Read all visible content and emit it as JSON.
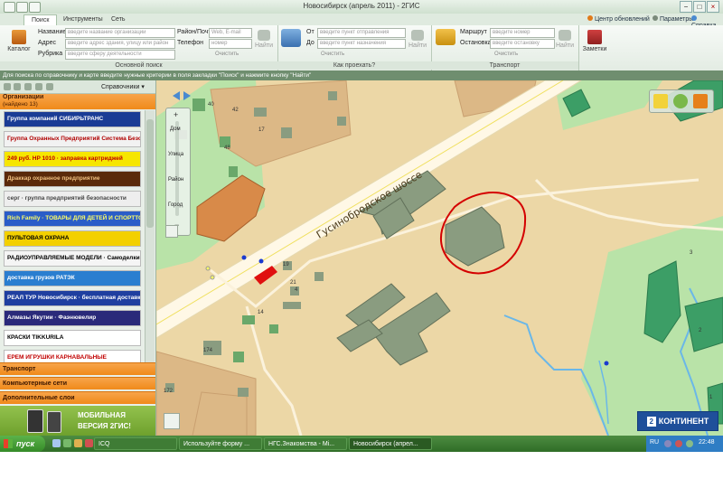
{
  "window": {
    "title": "Новосибирск (апрель 2011) - 2ГИС",
    "controls": [
      "−",
      "□",
      "×"
    ]
  },
  "tabs": [
    {
      "label": "Поиск",
      "active": true
    },
    {
      "label": "Инструменты",
      "active": false
    },
    {
      "label": "Сеть",
      "active": false
    }
  ],
  "top_links": {
    "updates": "Центр обновлений",
    "settings": "Параметры",
    "help": "Справка"
  },
  "ribbon": {
    "basic_search": {
      "group_label": "Основной поиск",
      "catalog_label": "Каталог",
      "labels": {
        "name": "Название",
        "address": "Адрес",
        "rubric": "Рубрика",
        "city": "Район/Почта",
        "phone": "Телефон"
      },
      "placeholders": {
        "name": "введите название организации",
        "address": "введите адрес здания, улицу или район",
        "rubric": "введите сферу деятельности",
        "web": "Web, E-mail",
        "phone": "номер"
      },
      "clear_label": "Очистить",
      "find_label": "Найти"
    },
    "route": {
      "group_label": "Как проехать?",
      "labels": {
        "from": "От",
        "to": "До"
      },
      "placeholders": {
        "from": "введите пункт отправления",
        "to": "введите пункт назначения"
      },
      "clear_label": "Очистить",
      "find_label": "Найти"
    },
    "transport": {
      "group_label": "Транспорт",
      "labels": {
        "route": "Маршрут",
        "stop": "Остановка"
      },
      "placeholders": {
        "route": "введите номер",
        "stop": "введите остановку"
      },
      "clear_label": "Очистить",
      "find_label": "Найти"
    },
    "notes": {
      "label": "Заметки"
    }
  },
  "info_strip": "Для поиска по справочнику и карте введите нужные критерии в поля закладки \"Поиск\" и нажмите кнопку \"Найти\"",
  "left_panel": {
    "toolbar_dropdown": "Справочники",
    "org_header": "Организации",
    "org_count": "(найдено 13)",
    "ads": [
      {
        "text": "Группа компаний СИБИРЬТРАНС",
        "bg": "#1a3c95",
        "fg": "#ffffff"
      },
      {
        "text": "Группа Охранных Предприятий Система Безопасности «ФАКТОР»",
        "bg": "#f2f2f2",
        "fg": "#b00000"
      },
      {
        "text": "249 руб. HP 1010 · заправка картриджей",
        "bg": "#f6e600",
        "fg": "#c00000"
      },
      {
        "text": "Драккар охранное предприятие",
        "bg": "#5a2a0a",
        "fg": "#f0c080"
      },
      {
        "text": "серг · группа предприятий безопасности",
        "bg": "#eeeeee",
        "fg": "#444444"
      },
      {
        "text": "Rich Family · ТОВАРЫ ДЛЯ ДЕТЕЙ И СПОРТТОВАРЫ",
        "bg": "#2a5dc8",
        "fg": "#ffff66"
      },
      {
        "text": "ПУЛЬТОВАЯ ОХРАНА",
        "bg": "#f3d000",
        "fg": "#000000"
      },
      {
        "text": "РАДИОУПРАВЛЯЕМЫЕ МОДЕЛИ · Самоделкин",
        "bg": "#f5f5f5",
        "fg": "#000000"
      },
      {
        "text": "доставка грузов РАТЭК",
        "bg": "#2a7ed0",
        "fg": "#ffffff"
      },
      {
        "text": "РЕАЛ ТУР Новосибирск · бесплатная доставка АВИАБИЛЕТОВ",
        "bg": "#1f3fa0",
        "fg": "#ffffff"
      },
      {
        "text": "Алмазы Якутии · Фаэнювелир",
        "bg": "#2a2a7a",
        "fg": "#ffffff"
      },
      {
        "text": "КРАСКИ TIKKURILA",
        "bg": "#ffffff",
        "fg": "#000000"
      },
      {
        "text": "ЕРЕМ ИГРУШКИ КАРНАВАЛЬНЫЕ",
        "bg": "#ffffff",
        "fg": "#c00000"
      }
    ],
    "sections": [
      "Транспорт",
      "Компьютерные сети",
      "Дополнительные слои"
    ],
    "mobile_banner": [
      "МОБИЛЬНАЯ",
      "ВЕРСИЯ 2ГИС!"
    ]
  },
  "map": {
    "street_label": "Гусинобродское шоссе",
    "zoom_labels": [
      "Дом",
      "Улица",
      "Район",
      "Город"
    ],
    "building_numbers": [
      "40",
      "42",
      "17",
      "48",
      "19",
      "21",
      "4",
      "14",
      "174",
      "172",
      "3",
      "2",
      "1"
    ],
    "brand": "КОНТИНЕНТ",
    "brand_mark": "2",
    "highlight_color": "#d40000"
  },
  "taskbar": {
    "start": "пуск",
    "tasks": [
      "ICQ",
      "Используйте форму ...",
      "НГС.Знакомства - Mi...",
      "Новосибирск (апрел..."
    ],
    "lang": "RU",
    "clock": "22:48"
  }
}
